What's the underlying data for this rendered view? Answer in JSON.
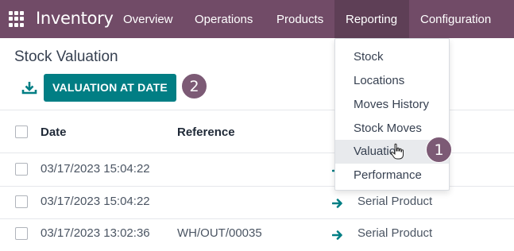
{
  "app": {
    "title": "Inventory"
  },
  "nav": {
    "items": [
      {
        "label": "Overview"
      },
      {
        "label": "Operations"
      },
      {
        "label": "Products"
      },
      {
        "label": "Reporting"
      },
      {
        "label": "Configuration"
      }
    ],
    "active": "Reporting"
  },
  "page": {
    "title": "Stock Valuation"
  },
  "actions": {
    "primary_label": "VALUATION AT DATE"
  },
  "badges": {
    "step1": "1",
    "step2": "2"
  },
  "table": {
    "columns": [
      "Date",
      "Reference"
    ],
    "rows": [
      {
        "date": "03/17/2023 15:04:22",
        "reference": "",
        "product": ""
      },
      {
        "date": "03/17/2023 15:04:22",
        "reference": "",
        "product": "Serial Product"
      },
      {
        "date": "03/17/2023 13:02:36",
        "reference": "WH/OUT/00035",
        "product": "Serial Product"
      }
    ]
  },
  "reporting_menu": {
    "items": [
      {
        "label": "Stock"
      },
      {
        "label": "Locations"
      },
      {
        "label": "Moves History"
      },
      {
        "label": "Stock Moves"
      },
      {
        "label": "Valuation"
      },
      {
        "label": "Performance"
      }
    ],
    "highlighted": "Valuation"
  },
  "colors": {
    "topbar": "#714b67",
    "primary_button": "#017e84",
    "badge": "#7c5a75",
    "arrow": "#017e84"
  }
}
